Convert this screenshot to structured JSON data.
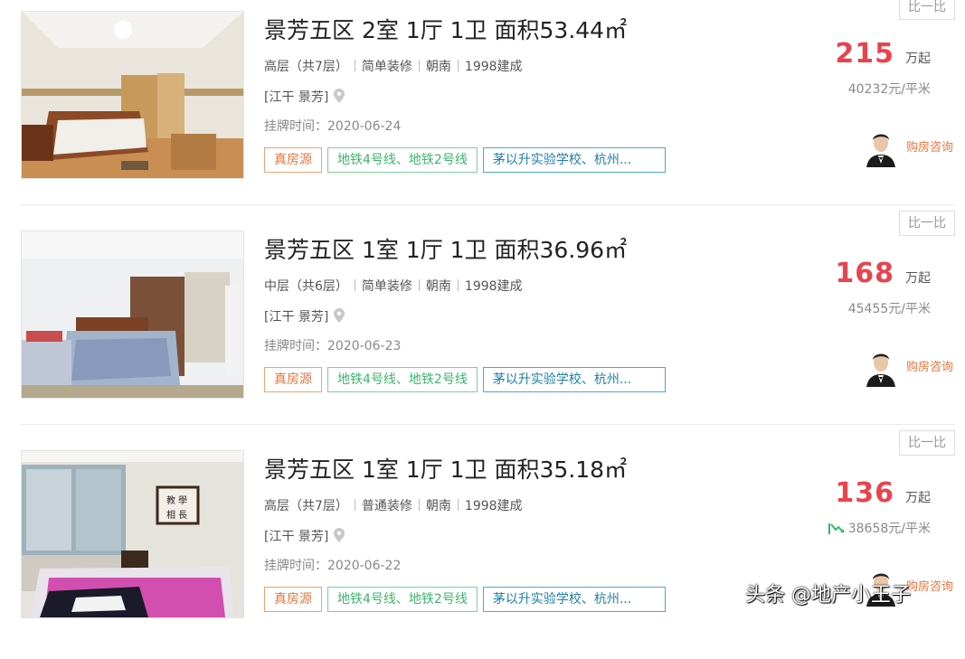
{
  "listings": [
    {
      "title": "景芳五区 2室 1厅 1卫 面积53.44㎡",
      "floor": "高层（共7层）",
      "decoration": "简单装修",
      "orientation": "朝南",
      "built": "1998建成",
      "location": "[江干 景芳]",
      "listed": "挂牌时间：2020-06-24",
      "tags": [
        "真房源",
        "地铁4号线、地铁2号线",
        "茅以升实验学校、杭州..."
      ],
      "price": "215",
      "price_unit": "万起",
      "unit_price": "40232元/平米",
      "compare": "比一比",
      "consult": "购房咨询"
    },
    {
      "title": "景芳五区 1室 1厅 1卫 面积36.96㎡",
      "floor": "中层（共6层）",
      "decoration": "简单装修",
      "orientation": "朝南",
      "built": "1998建成",
      "location": "[江干 景芳]",
      "listed": "挂牌时间：2020-06-23",
      "tags": [
        "真房源",
        "地铁4号线、地铁2号线",
        "茅以升实验学校、杭州..."
      ],
      "price": "168",
      "price_unit": "万起",
      "unit_price": "45455元/平米",
      "compare": "比一比",
      "consult": "购房咨询"
    },
    {
      "title": "景芳五区 1室 1厅 1卫 面积35.18㎡",
      "floor": "高层（共7层）",
      "decoration": "普通装修",
      "orientation": "朝南",
      "built": "1998建成",
      "location": "[江干 景芳]",
      "listed": "挂牌时间：2020-06-22",
      "tags": [
        "真房源",
        "地铁4号线、地铁2号线",
        "茅以升实验学校、杭州..."
      ],
      "price": "136",
      "price_unit": "万起",
      "unit_price": "38658元/平米",
      "unit_price_trend": "price-down-icon",
      "compare": "比一比",
      "consult": "购房咨询"
    }
  ],
  "watermark": "头条 @地产小王子",
  "colors": {
    "price": "#e9434d",
    "tag_verified": "#e8743b",
    "tag_metro": "#3db46d",
    "tag_school": "#1c80a6",
    "consult": "#e8743b"
  }
}
